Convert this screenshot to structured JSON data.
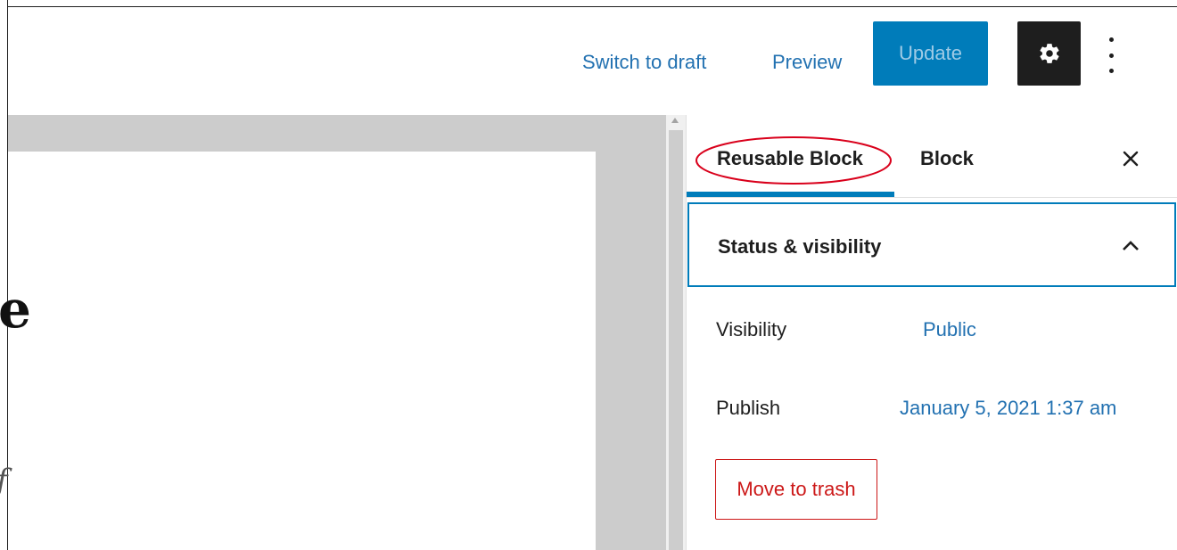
{
  "header": {
    "switch_to_draft": "Switch to draft",
    "preview": "Preview",
    "update": "Update",
    "settings_icon": "gear-icon",
    "more_icon": "vertical-ellipsis-icon"
  },
  "canvas": {
    "partial_heading_glyph": "e",
    "partial_text_glyph": "f"
  },
  "sidebar": {
    "tabs": [
      {
        "label": "Reusable Block",
        "active": true
      },
      {
        "label": "Block",
        "active": false
      }
    ],
    "close_icon": "close-icon",
    "panel": {
      "title": "Status & visibility",
      "expanded": true,
      "rows": [
        {
          "label": "Visibility",
          "value": "Public"
        },
        {
          "label": "Publish",
          "value": "January 5, 2021 1:37 am"
        }
      ],
      "trash_label": "Move to trash"
    }
  },
  "colors": {
    "accent": "#007cba",
    "link": "#2271b1",
    "danger": "#cc1818",
    "annotation": "#d9001b"
  }
}
